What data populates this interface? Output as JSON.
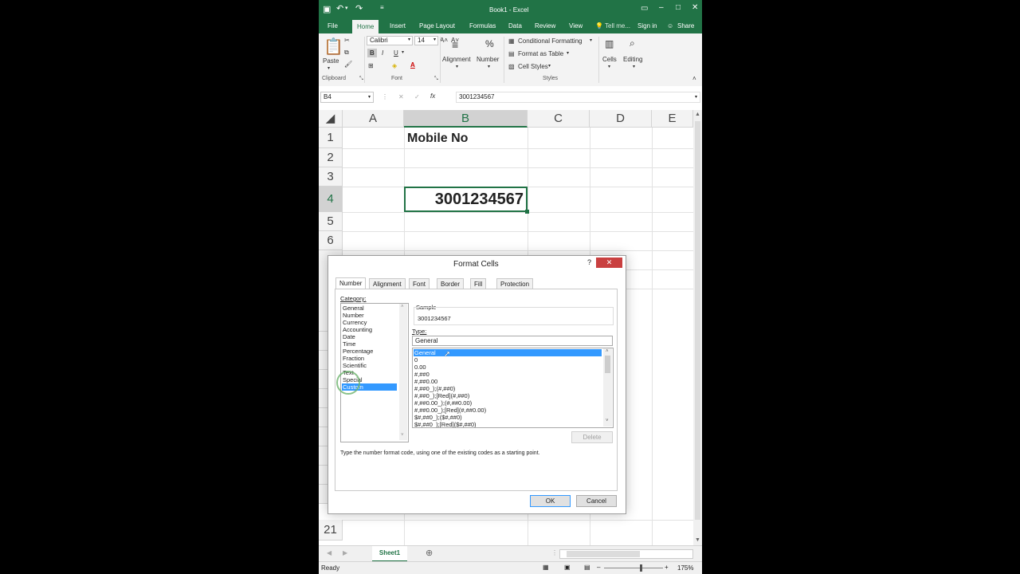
{
  "title_bar": {
    "title": "Book1 - Excel"
  },
  "ribbon_tabs": [
    "File",
    "Home",
    "Insert",
    "Page Layout",
    "Formulas",
    "Data",
    "Review",
    "View"
  ],
  "tell_me": "Tell me...",
  "sign_in": "Sign in",
  "share": "Share",
  "ribbon": {
    "paste": "Paste",
    "font_name": "Calibri",
    "font_size": "14",
    "bold": "B",
    "italic": "I",
    "underline": "U",
    "alignment": "Alignment",
    "number": "Number",
    "cond_format": "Conditional Formatting",
    "format_table": "Format as Table",
    "cell_styles": "Cell Styles",
    "cells": "Cells",
    "editing": "Editing",
    "groups": {
      "clipboard": "Clipboard",
      "font": "Font",
      "styles": "Styles"
    }
  },
  "formula_bar": {
    "name_box": "B4",
    "fx": "fx",
    "value": "3001234567"
  },
  "columns": [
    "A",
    "B",
    "C",
    "D",
    "E"
  ],
  "rows": [
    "1",
    "2",
    "3",
    "4",
    "5",
    "6"
  ],
  "row_partial_labels": [
    "1",
    "1",
    "1",
    "1",
    "1",
    "1",
    "1",
    "1",
    "1",
    "2"
  ],
  "last_row": "21",
  "cells": {
    "B1": "Mobile No",
    "B4": "3001234567"
  },
  "sheet_tab": "Sheet1",
  "status": {
    "ready": "Ready",
    "zoom": "175%"
  },
  "dialog": {
    "title": "Format Cells",
    "help": "?",
    "tabs": [
      "Number",
      "Alignment",
      "Font",
      "Border",
      "Fill",
      "Protection"
    ],
    "category_label": "Category:",
    "categories": [
      "General",
      "Number",
      "Currency",
      "Accounting",
      "Date",
      "Time",
      "Percentage",
      "Fraction",
      "Scientific",
      "Text",
      "Special",
      "Custom"
    ],
    "selected_category": "Custom",
    "sample_label": "Sample",
    "sample_value": "3001234567",
    "type_label": "Type:",
    "type_value": "General",
    "formats": [
      "General",
      "0",
      "0.00",
      "#,##0",
      "#,##0.00",
      "#,##0_);(#,##0)",
      "#,##0_);[Red](#,##0)",
      "#,##0.00_);(#,##0.00)",
      "#,##0.00_);[Red](#,##0.00)",
      "$#,##0_);($#,##0)",
      "$#,##0_);[Red]($#,##0)"
    ],
    "delete": "Delete",
    "hint": "Type the number format code, using one of the existing codes as a starting point.",
    "ok": "OK",
    "cancel": "Cancel"
  },
  "colors": {
    "excel_green": "#217346",
    "selection_blue": "#3399ff",
    "close_red": "#c94040"
  }
}
